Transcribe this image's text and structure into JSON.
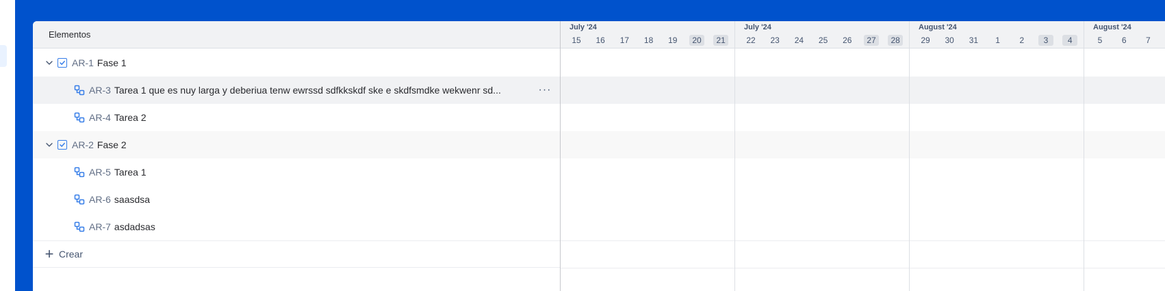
{
  "list_header": {
    "label": "Elementos"
  },
  "rows": [
    {
      "type": "group",
      "key": "AR-1",
      "title": "Fase 1"
    },
    {
      "type": "task",
      "key": "AR-3",
      "title": "Tarea 1 que es nuy larga y deberiua tenw ewrssd sdfkkskdf ske e skdfsmdke wekwenr sd...",
      "more_label": "···"
    },
    {
      "type": "task",
      "key": "AR-4",
      "title": "Tarea 2"
    },
    {
      "type": "group",
      "key": "AR-2",
      "title": "Fase 2"
    },
    {
      "type": "task",
      "key": "AR-5",
      "title": "Tarea 1"
    },
    {
      "type": "task",
      "key": "AR-6",
      "title": "saasdsa"
    },
    {
      "type": "task",
      "key": "AR-7",
      "title": "asdadsas"
    }
  ],
  "create": {
    "label": "Crear",
    "icon": "plus-icon"
  },
  "timeline": {
    "weeks": [
      {
        "month": "July '24",
        "days": [
          "15",
          "16",
          "17",
          "18",
          "19",
          "20",
          "21"
        ],
        "weekend": [
          false,
          false,
          false,
          false,
          false,
          true,
          true
        ]
      },
      {
        "month": "July '24",
        "days": [
          "22",
          "23",
          "24",
          "25",
          "26",
          "27",
          "28"
        ],
        "weekend": [
          false,
          false,
          false,
          false,
          false,
          true,
          true
        ]
      },
      {
        "month": "August '24",
        "days": [
          "29",
          "30",
          "31",
          "1",
          "2",
          "3",
          "4"
        ],
        "weekend": [
          false,
          false,
          false,
          false,
          false,
          true,
          true
        ]
      },
      {
        "month": "August '24",
        "days": [
          "5",
          "6",
          "7"
        ],
        "weekend": [
          false,
          false,
          false
        ]
      }
    ]
  },
  "colors": {
    "frame": "#0052cc",
    "accent": "#357de8",
    "header_bg": "#f1f2f4",
    "key_text": "#626f86"
  }
}
